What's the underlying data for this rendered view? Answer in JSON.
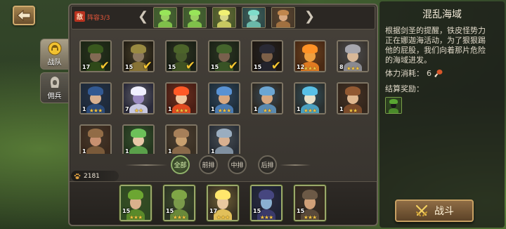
{
  "window": {
    "back_icon": "back-arrow-icon"
  },
  "tabs": [
    {
      "label": "战队",
      "icon": "helmet-icon",
      "selected": true
    },
    {
      "label": "佣兵",
      "icon": "hooded-head-icon",
      "selected": false
    }
  ],
  "enemy_bar": {
    "badge": "敌",
    "lineup": "阵容3/3",
    "prev_icon": "chevron-left-icon",
    "next_icon": "chevron-right-icon",
    "enemies": [
      {
        "portrait": "green-dragon-portrait",
        "bg": "#3e5a2e",
        "accent": "#7fbf4a",
        "skin": "#9ad060"
      },
      {
        "portrait": "green-dragon-portrait",
        "bg": "#3e5a2e",
        "accent": "#7fbf4a",
        "skin": "#9ad060"
      },
      {
        "portrait": "swamp-beast-portrait",
        "bg": "#4a5a2a",
        "accent": "#c8c860",
        "skin": "#d8d888"
      },
      {
        "portrait": "teal-ghoul-portrait",
        "bg": "#2e4a4a",
        "accent": "#6ab8a8",
        "skin": "#a0d8c8"
      },
      {
        "portrait": "pirate-captain-portrait",
        "bg": "#4a3a2a",
        "accent": "#a07040",
        "skin": "#d8a880"
      }
    ]
  },
  "roster": [
    [
      {
        "portrait": "green-hooded-archer-portrait",
        "level": "17",
        "stars": 0,
        "selected": true,
        "bg": "#2e3f22",
        "accent": "#4f7a2a",
        "skin": "#d9b08c"
      },
      {
        "portrait": "blonde-knight-portrait",
        "level": "15",
        "stars": 0,
        "selected": true,
        "bg": "#3a3222",
        "accent": "#e2c05a",
        "skin": "#e8c8a0"
      },
      {
        "portrait": "orc-warrior-portrait",
        "level": "15",
        "stars": 0,
        "selected": true,
        "bg": "#2c3524",
        "accent": "#6a8a3a",
        "skin": "#7a9a4a"
      },
      {
        "portrait": "forest-druid-portrait",
        "level": "15",
        "stars": 0,
        "selected": true,
        "bg": "#2e3a26",
        "accent": "#5e8a3e",
        "skin": "#c8a080"
      },
      {
        "portrait": "pirate-swordsman-portrait",
        "level": "15",
        "stars": 0,
        "selected": true,
        "bg": "#33281e",
        "accent": "#3a3a4a",
        "skin": "#d0a078"
      },
      {
        "portrait": "fire-fox-beast-portrait",
        "level": "12",
        "stars": 3,
        "selected": false,
        "bg": "#4a2a14",
        "accent": "#e07a20",
        "skin": "#f0a040"
      },
      {
        "portrait": "armored-elder-portrait",
        "level": "8",
        "stars": 3,
        "selected": false,
        "bg": "#3a3530",
        "accent": "#8a8a90",
        "skin": "#d8b898"
      }
    ],
    [
      {
        "portrait": "blue-hat-pirate-portrait",
        "level": "1",
        "stars": 3,
        "selected": false,
        "bg": "#1e2a3a",
        "accent": "#2a4a7a",
        "skin": "#d8b090"
      },
      {
        "portrait": "dark-elf-portrait",
        "level": "7",
        "stars": 2,
        "selected": false,
        "bg": "#2a2a3a",
        "accent": "#c8c8e0",
        "skin": "#9a8ac0"
      },
      {
        "portrait": "fire-sorceress-portrait",
        "level": "1",
        "stars": 3,
        "selected": false,
        "bg": "#4a1e14",
        "accent": "#e04a20",
        "skin": "#f0c8a0"
      },
      {
        "portrait": "blue-dwarf-portrait",
        "level": "1",
        "stars": 3,
        "selected": false,
        "bg": "#1e2e3a",
        "accent": "#4a7ab0",
        "skin": "#d8a880"
      },
      {
        "portrait": "dwarf-gunner-portrait",
        "level": "1",
        "stars": 2,
        "selected": false,
        "bg": "#2e2a24",
        "accent": "#5a8ab0",
        "skin": "#d8a880"
      },
      {
        "portrait": "skeleton-warrior-portrait",
        "level": "1",
        "stars": 3,
        "selected": false,
        "bg": "#2a3030",
        "accent": "#4aa0c0",
        "skin": "#e8e0c8"
      },
      {
        "portrait": "brown-haired-fighter-portrait",
        "level": "1",
        "stars": 2,
        "selected": false,
        "bg": "#33261c",
        "accent": "#7a4a2a",
        "skin": "#e0b890"
      }
    ],
    [
      {
        "portrait": "boar-warrior-portrait",
        "level": "1",
        "stars": 0,
        "selected": false,
        "bg": "#3a2a1e",
        "accent": "#7a5a3a",
        "skin": "#c89070"
      },
      {
        "portrait": "leaf-elf-portrait",
        "level": "1",
        "stars": 0,
        "selected": false,
        "bg": "#24361e",
        "accent": "#5aa04a",
        "skin": "#e8c8a8"
      },
      {
        "portrait": "bald-orc-portrait",
        "level": "1",
        "stars": 0,
        "selected": false,
        "bg": "#3a3024",
        "accent": "#8a6a4a",
        "skin": "#c8a070"
      },
      {
        "portrait": "gray-dwarf-portrait",
        "level": "1",
        "stars": 0,
        "selected": false,
        "bg": "#2a3038",
        "accent": "#8090a0",
        "skin": "#d8b090"
      }
    ]
  ],
  "filters": [
    {
      "label": "全部",
      "active": true
    },
    {
      "label": "前排",
      "active": false
    },
    {
      "label": "中排",
      "active": false
    },
    {
      "label": "后排",
      "active": false
    }
  ],
  "power": {
    "icon": "paw-icon",
    "value": "2181"
  },
  "team": [
    {
      "portrait": "green-hooded-archer-portrait",
      "level": "15",
      "stars": 3,
      "bg": "#2e4a22",
      "accent": "#5a8a2a",
      "skin": "#d9b08c"
    },
    {
      "portrait": "orc-warrior-portrait",
      "level": "15",
      "stars": 3,
      "bg": "#2c3524",
      "accent": "#6a8a3a",
      "skin": "#7a9a4a"
    },
    {
      "portrait": "blonde-knight-portrait",
      "level": "17",
      "stars": 3,
      "bg": "#3a3222",
      "accent": "#e2c05a",
      "skin": "#e8c8a0"
    },
    {
      "portrait": "dark-wizard-portrait",
      "level": "15",
      "stars": 3,
      "bg": "#1e2234",
      "accent": "#3a3a6a",
      "skin": "#8ab0d0"
    },
    {
      "portrait": "pirate-swordsman-portrait",
      "level": "15",
      "stars": 3,
      "bg": "#33281e",
      "accent": "#5a4a3a",
      "skin": "#d0a078"
    }
  ],
  "stage": {
    "title": "混乱海域",
    "description_lines": [
      "根据剑圣的提醒，铁皮怪势力",
      "正在娜迦海活动，为了狠狠踢",
      "他的屁股，我们向着那片危险",
      "的海域进发。"
    ],
    "cost_label": "体力消耗：",
    "cost_value": "6",
    "cost_icon": "meat-icon",
    "reward_label": "结算奖励：",
    "rewards": [
      {
        "portrait": "green-hooded-hero-icon",
        "bg": "#2a3a1e",
        "accent": "#4a8a2a",
        "skin": "#1a1a1a"
      }
    ]
  },
  "battle_button": {
    "label": "战斗",
    "icon": "crossed-swords-icon"
  },
  "colors": {
    "gold": "#f3c530",
    "enemy_red": "#e8563a",
    "star": "#f5c542",
    "active_filter": "#8fb06a"
  }
}
